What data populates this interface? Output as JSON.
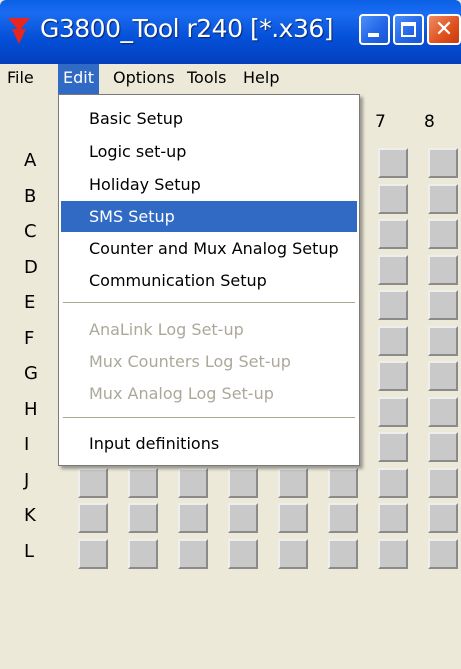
{
  "window": {
    "title": "G3800_Tool r240 [*.x36]",
    "accent_color": "#0a5fe6",
    "icon": "red-triangle-icon"
  },
  "menubar": {
    "items": [
      {
        "label": "File"
      },
      {
        "label": "Edit"
      },
      {
        "label": "Options"
      },
      {
        "label": "Tools"
      },
      {
        "label": "Help"
      }
    ]
  },
  "edit_menu": {
    "items": [
      {
        "label": "Basic Setup",
        "enabled": true
      },
      {
        "label": "Logic set-up",
        "enabled": true
      },
      {
        "label": "Holiday Setup",
        "enabled": true
      },
      {
        "label": "SMS Setup",
        "enabled": true,
        "highlighted": true
      },
      {
        "label": "Counter and Mux Analog Setup",
        "enabled": true
      },
      {
        "label": "Communication Setup",
        "enabled": true
      },
      {
        "label": "AnaLink Log Set-up",
        "enabled": false
      },
      {
        "label": "Mux Counters Log Set-up",
        "enabled": false
      },
      {
        "label": "Mux Analog Log Set-up",
        "enabled": false
      },
      {
        "label": "Input definitions",
        "enabled": true
      }
    ]
  },
  "grid": {
    "columns": [
      "7",
      "8"
    ],
    "rows": [
      "A",
      "B",
      "C",
      "D",
      "E",
      "F",
      "G",
      "H",
      "I",
      "J",
      "K",
      "L"
    ]
  }
}
